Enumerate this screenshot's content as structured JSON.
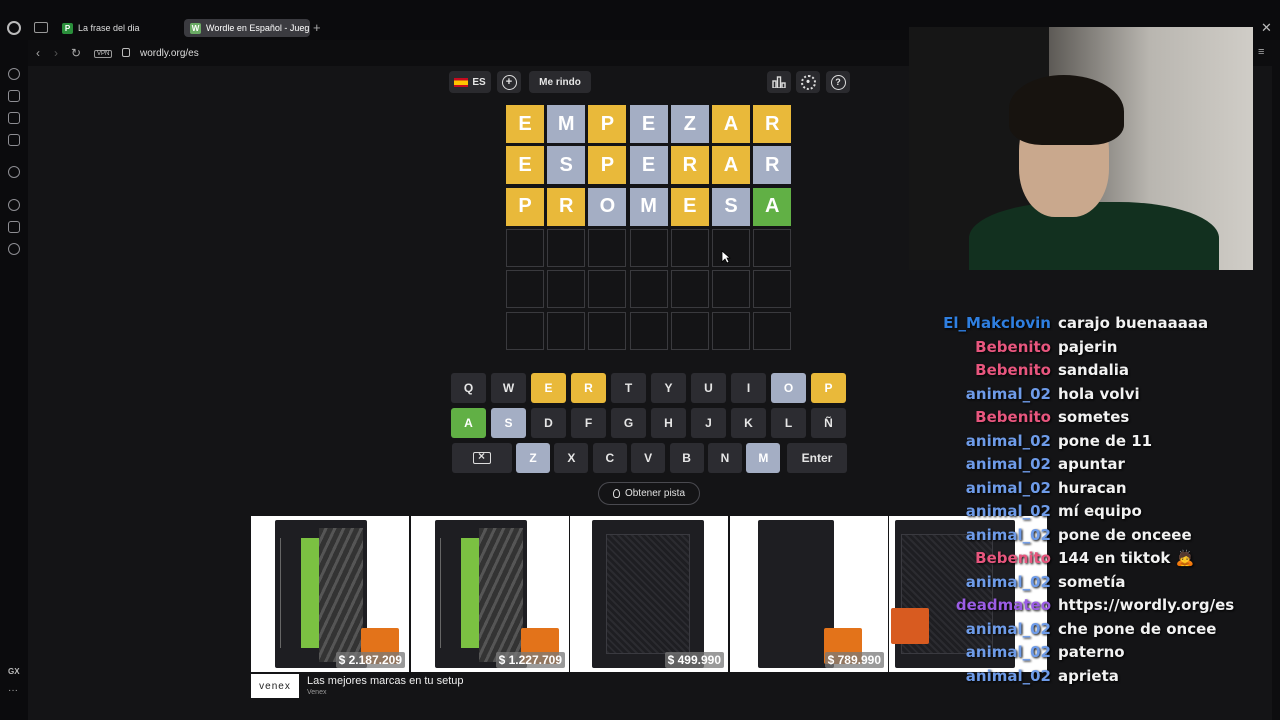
{
  "browser": {
    "tabs": [
      {
        "label": "La frase del dia",
        "favicon": "P",
        "favicon_color": "#2a8f3b"
      },
      {
        "label": "Wordle en Español - Jueg",
        "favicon": "W",
        "favicon_color": "#6aaa64"
      }
    ],
    "new_tab": "+",
    "vpn_label": "VPN",
    "url": "wordly.org/es",
    "sidebar_bottom": "GX"
  },
  "wordle": {
    "language": "ES",
    "give_up": "Me rindo",
    "hint": "Obtener pista",
    "colors": {
      "yellow": "#e9b93a",
      "gray": "#a4aec4",
      "green": "#61b045"
    },
    "rows": [
      {
        "letters": [
          "E",
          "M",
          "P",
          "E",
          "Z",
          "A",
          "R"
        ],
        "states": [
          "yellow",
          "gray",
          "yellow",
          "gray",
          "gray",
          "yellow",
          "yellow"
        ]
      },
      {
        "letters": [
          "E",
          "S",
          "P",
          "E",
          "R",
          "A",
          "R"
        ],
        "states": [
          "yellow",
          "gray",
          "yellow",
          "gray",
          "yellow",
          "yellow",
          "gray"
        ]
      },
      {
        "letters": [
          "P",
          "R",
          "O",
          "M",
          "E",
          "S",
          "A"
        ],
        "states": [
          "yellow",
          "yellow",
          "gray",
          "gray",
          "yellow",
          "gray",
          "green"
        ]
      },
      {
        "letters": [
          "",
          "",
          "",
          "",
          "",
          "",
          ""
        ],
        "states": [
          "empty",
          "empty",
          "empty",
          "empty",
          "empty",
          "empty",
          "empty"
        ]
      },
      {
        "letters": [
          "",
          "",
          "",
          "",
          "",
          "",
          ""
        ],
        "states": [
          "empty",
          "empty",
          "empty",
          "empty",
          "empty",
          "empty",
          "empty"
        ]
      },
      {
        "letters": [
          "",
          "",
          "",
          "",
          "",
          "",
          ""
        ],
        "states": [
          "empty",
          "empty",
          "empty",
          "empty",
          "empty",
          "empty",
          "empty"
        ]
      }
    ],
    "keyboard": [
      [
        {
          "k": "Q"
        },
        {
          "k": "W"
        },
        {
          "k": "E",
          "s": "yellow"
        },
        {
          "k": "R",
          "s": "yellow"
        },
        {
          "k": "T"
        },
        {
          "k": "Y"
        },
        {
          "k": "U"
        },
        {
          "k": "I"
        },
        {
          "k": "O",
          "s": "gray"
        },
        {
          "k": "P",
          "s": "yellow"
        }
      ],
      [
        {
          "k": "A",
          "s": "green"
        },
        {
          "k": "S",
          "s": "gray"
        },
        {
          "k": "D"
        },
        {
          "k": "F"
        },
        {
          "k": "G"
        },
        {
          "k": "H"
        },
        {
          "k": "J"
        },
        {
          "k": "K"
        },
        {
          "k": "L"
        },
        {
          "k": "Ñ"
        }
      ],
      [
        {
          "k": "Z",
          "s": "gray"
        },
        {
          "k": "X"
        },
        {
          "k": "C"
        },
        {
          "k": "V"
        },
        {
          "k": "B"
        },
        {
          "k": "N"
        },
        {
          "k": "M",
          "s": "gray"
        }
      ]
    ],
    "enter_label": "Enter"
  },
  "ads": {
    "items": [
      {
        "price": "$ 2.187.209"
      },
      {
        "price": "$ 1.227.709"
      },
      {
        "price": "$ 499.990"
      },
      {
        "price": "$ 789.990"
      },
      {
        "price": ""
      }
    ],
    "logo": "venex",
    "title": "Las mejores marcas en tu setup",
    "brand": "Venex"
  },
  "chat": [
    {
      "user": "El_Makclovin",
      "text": "carajo buenaaaaa",
      "color": "#2f7fe0"
    },
    {
      "user": "Bebenito",
      "text": "pajerin",
      "color": "#e8567e"
    },
    {
      "user": "Bebenito",
      "text": "sandalia",
      "color": "#e8567e"
    },
    {
      "user": "animal_02",
      "text": "hola volvi",
      "color": "#6e9be8"
    },
    {
      "user": "Bebenito",
      "text": "sometes",
      "color": "#e8567e"
    },
    {
      "user": "animal_02",
      "text": "pone de 11",
      "color": "#6e9be8"
    },
    {
      "user": "animal_02",
      "text": "apuntar",
      "color": "#6e9be8"
    },
    {
      "user": "animal_02",
      "text": "huracan",
      "color": "#6e9be8"
    },
    {
      "user": "animal_02",
      "text": "mí equipo",
      "color": "#6e9be8"
    },
    {
      "user": "animal_02",
      "text": "pone de onceee",
      "color": "#6e9be8"
    },
    {
      "user": "Bebenito",
      "text": "144 en tiktok 🙇",
      "color": "#e8567e"
    },
    {
      "user": "animal_02",
      "text": "sometía",
      "color": "#6e9be8"
    },
    {
      "user": "deadmateo",
      "text": "https://wordly.org/es",
      "color": "#9b5de5"
    },
    {
      "user": "animal_02",
      "text": "che pone de oncee",
      "color": "#6e9be8"
    },
    {
      "user": "animal_02",
      "text": "paterno",
      "color": "#6e9be8"
    },
    {
      "user": "animal_02",
      "text": "aprieta",
      "color": "#6e9be8"
    }
  ]
}
